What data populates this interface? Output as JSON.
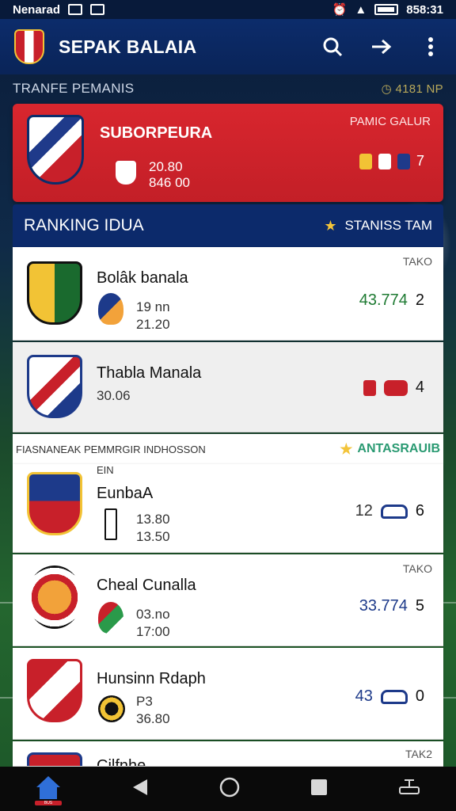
{
  "status_bar": {
    "carrier": "Nenarad",
    "time": "858:31"
  },
  "app_bar": {
    "title": "SEPAK BALAIA"
  },
  "transfer_section": {
    "title": "TRANFE PEMANIS",
    "right_label": "4181 NP",
    "card": {
      "club_name": "SUBORPEURA",
      "value_1": "20.80",
      "value_2": "846 00",
      "label": "PAMIC GALUR",
      "count": "7"
    }
  },
  "ranking": {
    "title": "RANKING IDUA",
    "right_label": "STANISS TAM",
    "rows": [
      {
        "name": "Bolâk banala",
        "tag": "TAKO",
        "line1": "19 nn",
        "line2": "21.20",
        "score": "43.774",
        "rank": "2"
      },
      {
        "name": "Thabla Manala",
        "tag": "",
        "line1": "30.06",
        "line2": "",
        "score": "",
        "rank": "4"
      }
    ]
  },
  "section2": {
    "label": "FIASNANEAK PEMMRGIR INDHOSSON",
    "right_label": "ANTASRAUIB"
  },
  "league_rows": [
    {
      "name": "EunbaA",
      "sub": "EIN",
      "tag": "",
      "line1": "13.80",
      "line2": "13.50",
      "score": "12",
      "rank": "6"
    },
    {
      "name": "Cheal Cunalla",
      "sub": "",
      "tag": "TAKO",
      "line1": "03.no",
      "line2": "17:00",
      "score": "33.774",
      "rank": "5"
    },
    {
      "name": "Hunsinn Rdaph",
      "sub": "",
      "tag": "",
      "line1": "P3",
      "line2": "36.80",
      "score": "43",
      "rank": "0"
    },
    {
      "name": "Cilfnhe",
      "sub": "",
      "tag": "TAK2",
      "line1": "",
      "line2": "",
      "score": "",
      "rank": ""
    }
  ],
  "bottom_nav": {
    "home_badge": "BUS"
  },
  "colors": {
    "appbar": "#0c2c6b",
    "transfer": "#d8262e",
    "accent_green": "#1e7a32",
    "accent_blue": "#1d3a8a"
  }
}
